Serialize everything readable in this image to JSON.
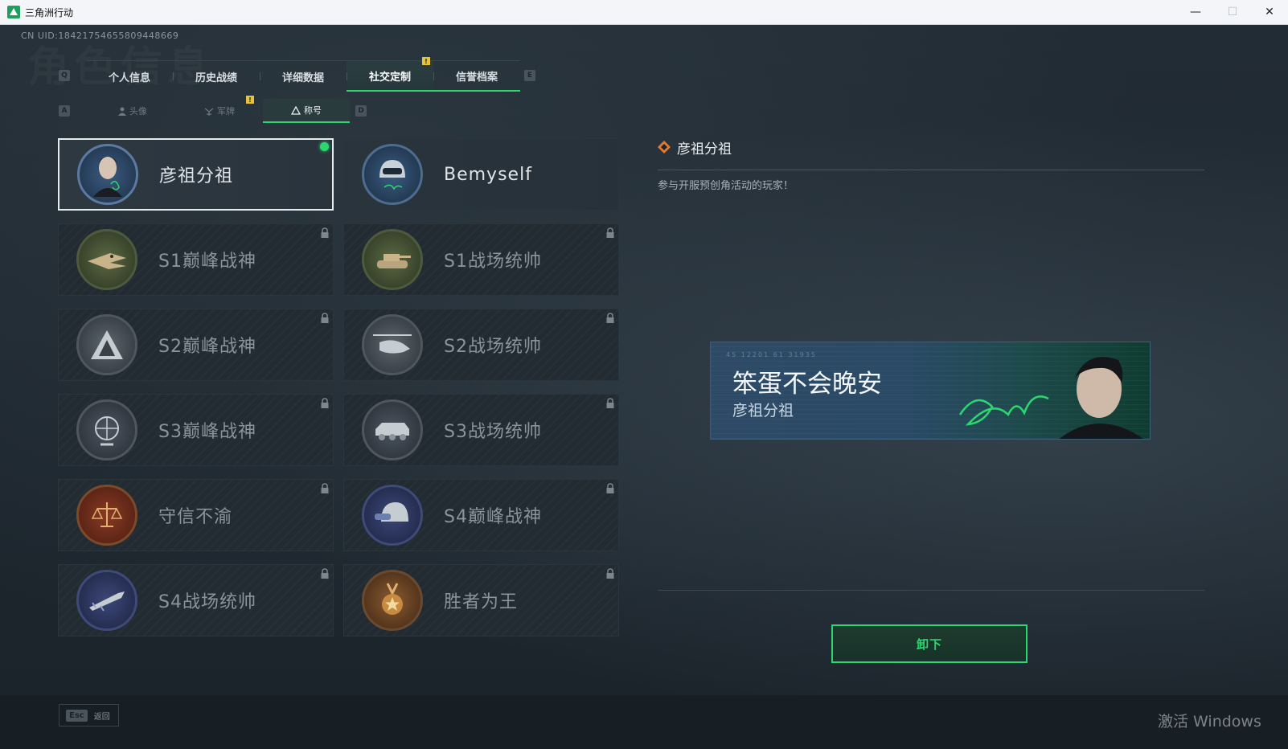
{
  "window": {
    "title": "三角洲行动",
    "minimize": "—",
    "maximize": "☐",
    "close": "✕"
  },
  "uid": "CN UID:18421754655809448669",
  "bg_title": "角色信息",
  "key_hints": {
    "prev_tab": "Q",
    "next_tab": "E",
    "prev_sub": "A",
    "next_sub": "D"
  },
  "main_tabs": [
    {
      "label": "个人信息"
    },
    {
      "label": "历史战绩"
    },
    {
      "label": "详细数据"
    },
    {
      "label": "社交定制",
      "active": true
    },
    {
      "label": "信誉档案"
    }
  ],
  "new_badge": "!",
  "sub_tabs": [
    {
      "label": "头像",
      "icon": "person-icon"
    },
    {
      "label": "军牌",
      "icon": "military-badge-icon"
    },
    {
      "label": "称号",
      "icon": "title-emblem-icon",
      "active": true
    }
  ],
  "titles": [
    {
      "name": "彦祖分祖",
      "state": "equipped",
      "emblem": "portrait-emblem-icon"
    },
    {
      "name": "Bemyself",
      "state": "owned",
      "emblem": "helmet-emblem-icon"
    },
    {
      "name": "S1巅峰战神",
      "state": "locked",
      "emblem": "crocodile-emblem-icon"
    },
    {
      "name": "S1战场统帅",
      "state": "locked",
      "emblem": "tank-emblem-icon"
    },
    {
      "name": "S2巅峰战神",
      "state": "locked",
      "emblem": "triangle-emblem-icon"
    },
    {
      "name": "S2战场统帅",
      "state": "locked",
      "emblem": "helicopter-emblem-icon"
    },
    {
      "name": "S3巅峰战神",
      "state": "locked",
      "emblem": "globe-emblem-icon"
    },
    {
      "name": "S3战场统帅",
      "state": "locked",
      "emblem": "armored-vehicle-emblem-icon"
    },
    {
      "name": "守信不渝",
      "state": "locked",
      "emblem": "scales-emblem-icon"
    },
    {
      "name": "S4巅峰战神",
      "state": "locked",
      "emblem": "helmet-nvg-emblem-icon"
    },
    {
      "name": "S4战场统帅",
      "state": "locked",
      "emblem": "missile-emblem-icon"
    },
    {
      "name": "胜者为王",
      "state": "locked",
      "emblem": "medal-emblem-icon"
    }
  ],
  "detail": {
    "title": "彦祖分祖",
    "description": "参与开服预创角活动的玩家！"
  },
  "preview": {
    "codes": "45 12201   61 31935",
    "line1": "笨蛋不会晚安",
    "line2": "彦祖分祖"
  },
  "unequip_label": "卸下",
  "footer": {
    "esc_key": "Esc",
    "esc_label": "返回",
    "activate_windows": "激活 Windows"
  },
  "colors": {
    "accent_green": "#2ed66f",
    "warning_yellow": "#e8c23a",
    "panel_bg": "#1d262e"
  }
}
